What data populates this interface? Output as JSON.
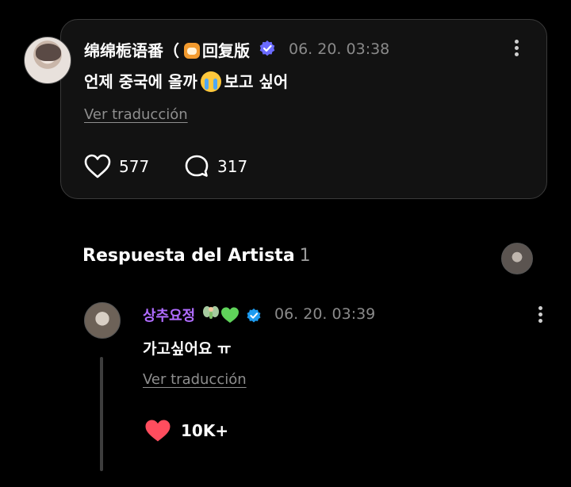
{
  "comment": {
    "author_name": "绵绵栀语番（",
    "author_tag": "回复版",
    "time": "06. 20. 03:38",
    "text_before_emoji": "언제 중국에 올까",
    "text_after_emoji": "보고 싶어",
    "translate_label": "Ver traducción",
    "likes": "577",
    "replies": "317"
  },
  "artist_section": {
    "title": "Respuesta del Artista",
    "count": "1"
  },
  "reply": {
    "author_name": "상추요정",
    "time": "06. 20. 03:39",
    "text": "가고싶어요 ㅠ",
    "translate_label": "Ver traducción",
    "likes": "10K+"
  },
  "colors": {
    "background": "#000000",
    "card": "#121212",
    "card_border": "#3a3a3a",
    "muted_text": "#8a8a8a",
    "reply_name": "#b06cff",
    "like_heart": "#ff4d5e",
    "verified_badge": "#6b6bff",
    "blue_check": "#1d9bf0"
  },
  "icons": {
    "heart_outline": "heart-icon",
    "comment_bubble": "comment-icon",
    "kebab": "more-vertical-icon",
    "verified": "verified-badge-icon",
    "heart_filled": "heart-filled-icon"
  }
}
